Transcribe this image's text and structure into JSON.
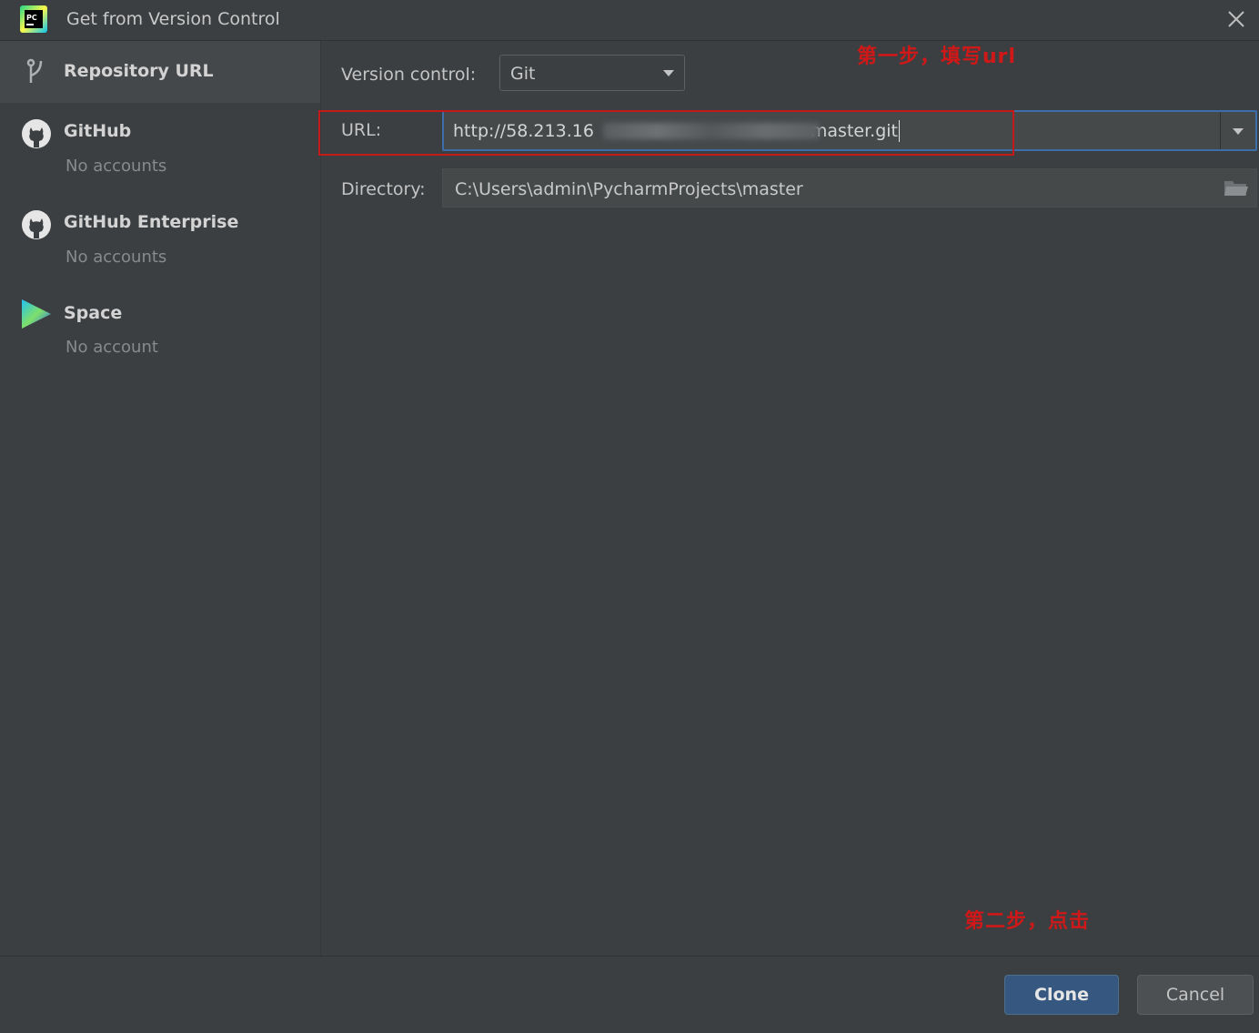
{
  "window": {
    "title": "Get from Version Control",
    "app_icon": "pycharm-icon",
    "app_icon_text": "PC"
  },
  "sidebar": {
    "items": [
      {
        "label": "Repository URL",
        "icon": "branch-icon",
        "selected": true
      },
      {
        "label": "GitHub",
        "sub": "No accounts",
        "icon": "github-icon"
      },
      {
        "label": "GitHub Enterprise",
        "sub": "No accounts",
        "icon": "github-icon"
      },
      {
        "label": "Space",
        "sub": "No account",
        "icon": "space-icon"
      }
    ]
  },
  "form": {
    "version_control_label": "Version control:",
    "version_control_value": "Git",
    "url_label": "URL:",
    "url_value_start": "http://58.213.16",
    "url_value_end": "master.git",
    "directory_label": "Directory:",
    "directory_value": "C:\\Users\\admin\\PycharmProjects\\master"
  },
  "annotations": {
    "step1": "第一步，填写url",
    "step2": "第二步，点击"
  },
  "buttons": {
    "clone": "Clone",
    "cancel": "Cancel"
  },
  "colors": {
    "background": "#3c3f41",
    "accent_focus": "#3d6ea9",
    "primary_button": "#365880",
    "annotation_red": "#d01818"
  }
}
